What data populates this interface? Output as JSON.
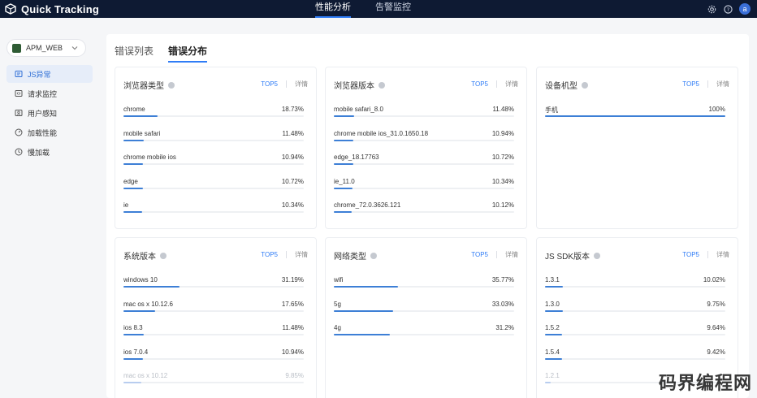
{
  "header": {
    "brand": "Quick Tracking",
    "nav": [
      {
        "label": "性能分析",
        "active": true
      },
      {
        "label": "告警监控",
        "active": false
      }
    ],
    "avatar_letter": "a"
  },
  "sidebar": {
    "app_name": "APM_WEB",
    "items": [
      {
        "label": "JS异常",
        "icon": "bug-icon",
        "active": true
      },
      {
        "label": "请求监控",
        "icon": "request-icon",
        "active": false
      },
      {
        "label": "用户感知",
        "icon": "user-icon",
        "active": false
      },
      {
        "label": "加载性能",
        "icon": "speed-icon",
        "active": false
      },
      {
        "label": "慢加载",
        "icon": "clock-icon",
        "active": false
      }
    ]
  },
  "tabs": [
    {
      "label": "错误列表",
      "active": false
    },
    {
      "label": "错误分布",
      "active": true
    }
  ],
  "card_common": {
    "top_label": "TOP5",
    "detail_label": "详情"
  },
  "cards": [
    {
      "title": "浏览器类型",
      "rows": [
        {
          "name": "chrome",
          "value": "18.73%",
          "pct": 18.73
        },
        {
          "name": "mobile safari",
          "value": "11.48%",
          "pct": 11.48
        },
        {
          "name": "chrome mobile ios",
          "value": "10.94%",
          "pct": 10.94
        },
        {
          "name": "edge",
          "value": "10.72%",
          "pct": 10.72
        },
        {
          "name": "ie",
          "value": "10.34%",
          "pct": 10.34
        }
      ]
    },
    {
      "title": "浏览器版本",
      "rows": [
        {
          "name": "mobile safari_8.0",
          "value": "11.48%",
          "pct": 11.48
        },
        {
          "name": "chrome mobile ios_31.0.1650.18",
          "value": "10.94%",
          "pct": 10.94
        },
        {
          "name": "edge_18.17763",
          "value": "10.72%",
          "pct": 10.72
        },
        {
          "name": "ie_11.0",
          "value": "10.34%",
          "pct": 10.34
        },
        {
          "name": "chrome_72.0.3626.121",
          "value": "10.12%",
          "pct": 10.12
        }
      ]
    },
    {
      "title": "设备机型",
      "rows": [
        {
          "name": "手机",
          "value": "100%",
          "pct": 100
        }
      ]
    },
    {
      "title": "系统版本",
      "rows": [
        {
          "name": "windows 10",
          "value": "31.19%",
          "pct": 31.19
        },
        {
          "name": "mac os x 10.12.6",
          "value": "17.65%",
          "pct": 17.65
        },
        {
          "name": "ios 8.3",
          "value": "11.48%",
          "pct": 11.48
        },
        {
          "name": "ios 7.0.4",
          "value": "10.94%",
          "pct": 10.94
        },
        {
          "name": "mac os x 10.12",
          "value": "9.85%",
          "pct": 9.85
        }
      ]
    },
    {
      "title": "网络类型",
      "rows": [
        {
          "name": "wifi",
          "value": "35.77%",
          "pct": 35.77
        },
        {
          "name": "5g",
          "value": "33.03%",
          "pct": 33.03
        },
        {
          "name": "4g",
          "value": "31.2%",
          "pct": 31.2
        }
      ]
    },
    {
      "title": "JS SDK版本",
      "rows": [
        {
          "name": "1.3.1",
          "value": "10.02%",
          "pct": 10.02
        },
        {
          "name": "1.3.0",
          "value": "9.75%",
          "pct": 9.75
        },
        {
          "name": "1.5.2",
          "value": "9.64%",
          "pct": 9.64
        },
        {
          "name": "1.5.4",
          "value": "9.42%",
          "pct": 9.42
        },
        {
          "name": "1.2.1",
          "value": "",
          "pct": 3
        }
      ]
    }
  ],
  "watermark": "码界编程网",
  "colors": {
    "accent": "#2f7cf6",
    "bar": "#3d7fd6",
    "topbar": "#0e1a33"
  }
}
